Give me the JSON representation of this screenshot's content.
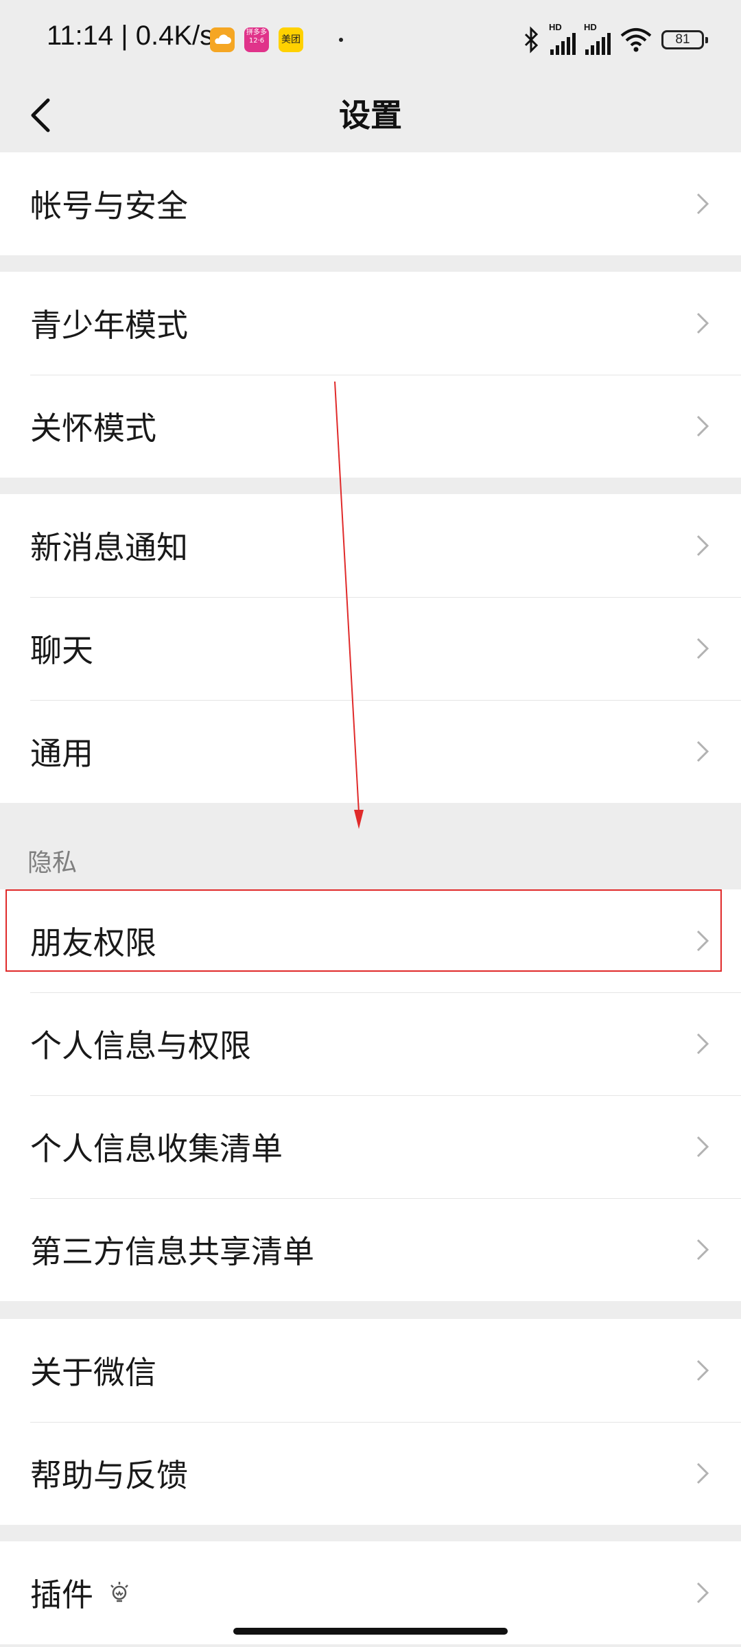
{
  "status_bar": {
    "time": "11:14 | 0.4K/s",
    "app_badges": [
      "weather-app",
      "pinduoduo-app",
      "meituan-app"
    ],
    "pdd_text": "拼多多 12·6",
    "meituan_text": "美团",
    "signal_labels": [
      "HD",
      "HD"
    ],
    "battery": "81"
  },
  "header": {
    "title": "设置",
    "back_icon": "chevron-left-icon"
  },
  "groups": {
    "account": [
      "帐号与安全"
    ],
    "mode": [
      "青少年模式",
      "关怀模式"
    ],
    "general": [
      "新消息通知",
      "聊天",
      "通用"
    ],
    "privacy_title": "隐私",
    "privacy": [
      "朋友权限",
      "个人信息与权限",
      "个人信息收集清单",
      "第三方信息共享清单"
    ],
    "about": [
      "关于微信",
      "帮助与反馈"
    ],
    "plugins": [
      "插件"
    ]
  },
  "icons": {
    "row_chevron": "chevron-right-icon",
    "plugin_badge": "lightbulb-icon"
  },
  "colors": {
    "background": "#ededed",
    "card": "#ffffff",
    "highlight": "#e02a2a"
  }
}
